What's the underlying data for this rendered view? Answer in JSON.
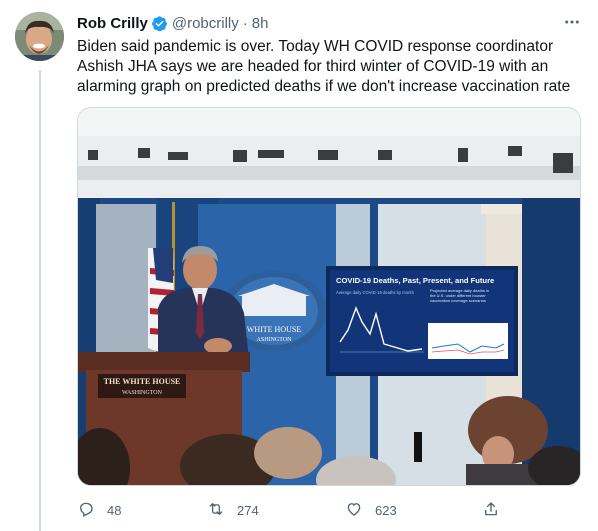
{
  "tweet": {
    "author_name": "Rob Crilly",
    "handle": "@robcrilly",
    "separator": "·",
    "time": "8h",
    "more": "···",
    "text": "Biden said pandemic is over. Today WH COVID response coordinator Ashish JHA says we are headed for third winter of COVID-19 with an alarming graph on predicted deaths if we don't increase vaccination rate"
  },
  "media": {
    "podium_sign_line1": "THE WHITE HOUSE",
    "podium_sign_line2": "WASHINGTON",
    "seal_line1": "WHITE HOUSE",
    "seal_line2": "ASHINGTON",
    "screen_title": "COVID-19 Deaths, Past, Present, and Future",
    "screen_left_label": "Average daily COVID-19 deaths by month",
    "screen_right_label_1": "Projected average daily deaths in",
    "screen_right_label_2": "the U.S. under different booster",
    "screen_right_label_3": "vaccination coverage scenarios"
  },
  "actions": {
    "reply_count": "48",
    "retweet_count": "274",
    "like_count": "623"
  },
  "colors": {
    "verified": "#1d9bf0",
    "text": "#0f1419",
    "secondary": "#536471"
  },
  "icons": [
    "verified-badge-icon",
    "more-icon",
    "reply-icon",
    "retweet-icon",
    "like-icon",
    "share-icon"
  ]
}
